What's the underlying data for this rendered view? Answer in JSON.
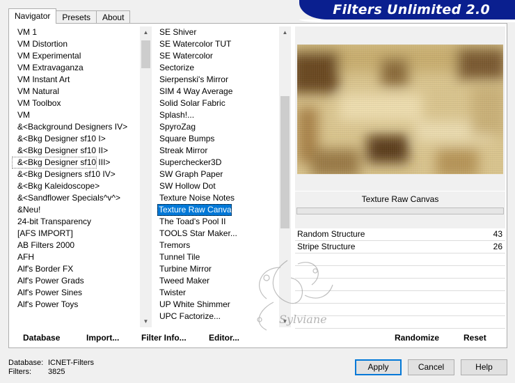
{
  "header": {
    "title": "Filters Unlimited 2.0",
    "tabs": [
      "Navigator",
      "Presets",
      "About"
    ]
  },
  "left_list": {
    "items": [
      "VM 1",
      "VM Distortion",
      "VM Experimental",
      "VM Extravaganza",
      "VM Instant Art",
      "VM Natural",
      "VM Toolbox",
      "VM",
      "&<Background Designers IV>",
      "&<Bkg Designer sf10 I>",
      "&<Bkg Designer sf10 II>",
      "&<Bkg Designer sf10 III>",
      "&<Bkg Designers sf10 IV>",
      "&<Bkg Kaleidoscope>",
      "&<Sandflower Specials^v^>",
      "&Neu!",
      "24-bit Transparency",
      "[AFS IMPORT]",
      "AB Filters 2000",
      "AFH",
      "Alf's Border FX",
      "Alf's Power Grads",
      "Alf's Power Sines",
      "Alf's Power Toys"
    ],
    "highlighted": "&<Bkg Designer sf10 III>"
  },
  "mid_list": {
    "items": [
      "SE Shiver",
      "SE Watercolor TUT",
      "SE Watercolor",
      "Sectorize",
      "Sierpenski's Mirror",
      "SIM 4 Way Average",
      "Solid Solar Fabric",
      "Splash!...",
      "SpyroZag",
      "Square Bumps",
      "Streak Mirror",
      "Superchecker3D",
      "SW Graph Paper",
      "SW Hollow Dot",
      "Texture Noise Notes",
      "Texture Raw Canvas",
      "The Toad's Pool II",
      "TOOLS Star Maker...",
      "Tremors",
      "Tunnel Tile",
      "Turbine Mirror",
      "Tweed Maker",
      "Twister",
      "UP White Shimmer",
      "UPC Factorize..."
    ],
    "selected": "Texture Raw Canvas"
  },
  "preview": {
    "filter_name": "Texture Raw Canvas",
    "params": [
      {
        "name": "Random Structure",
        "value": "43"
      },
      {
        "name": "Stripe Structure",
        "value": "26"
      }
    ],
    "watermark": "Sylviane"
  },
  "toolbar": {
    "database": "Database",
    "import": "Import...",
    "filter_info": "Filter Info...",
    "editor": "Editor...",
    "randomize": "Randomize",
    "reset": "Reset"
  },
  "footer": {
    "database_label": "Database:",
    "database_value": "ICNET-Filters",
    "filters_label": "Filters:",
    "filters_value": "3825",
    "apply": "Apply",
    "cancel": "Cancel",
    "help": "Help"
  },
  "colors": {
    "title_bar": "#0a1f8f",
    "selection": "#0078d7",
    "default_button_border": "#0078d7"
  }
}
